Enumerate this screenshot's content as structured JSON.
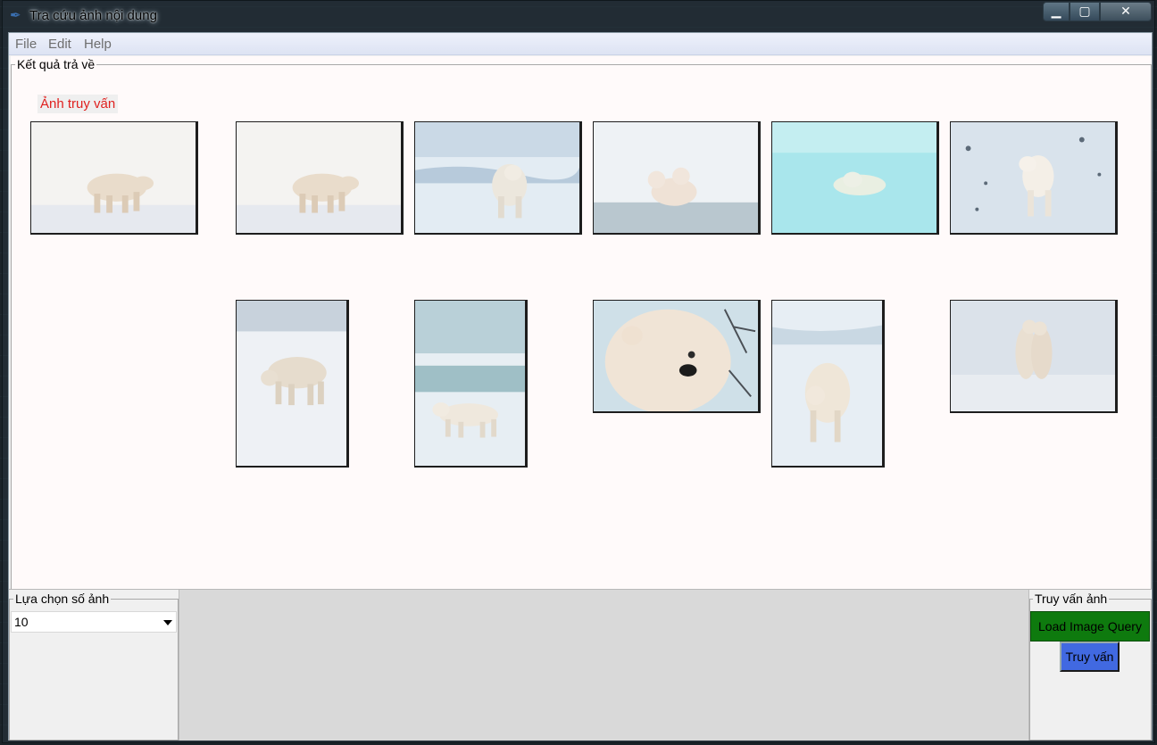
{
  "window": {
    "title": "Tra cứu ảnh nội dung"
  },
  "menu": {
    "items": [
      "File",
      "Edit",
      "Help"
    ]
  },
  "results": {
    "group_label": "Kết quả trả về",
    "query_label": "Ảnh truy vấn"
  },
  "controls": {
    "count_group_label": "Lựa chọn số ảnh",
    "count_value": "10",
    "query_group_label": "Truy vấn ảnh",
    "load_button": "Load Image Query",
    "query_button": "Truy vấn"
  },
  "colors": {
    "query_label_text": "#e0211f",
    "load_button_bg": "#0e7a0e",
    "query_button_bg": "#4169e1",
    "results_bg": "#fffafa"
  }
}
